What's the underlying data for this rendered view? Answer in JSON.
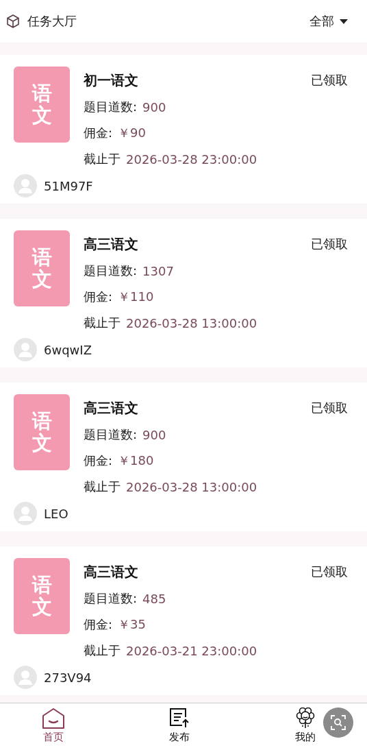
{
  "header": {
    "title": "任务大厅",
    "filter": "全部"
  },
  "tasks": [
    {
      "cover": "语文",
      "title": "初一语文",
      "status": "已领取",
      "count_label": "题目道数:",
      "count": "900",
      "fee_label": "佣金:",
      "fee": "￥90",
      "deadline_label": "截止于",
      "deadline": "2026-03-28 23:00:00",
      "user": "51M97F"
    },
    {
      "cover": "语文",
      "title": "高三语文",
      "status": "已领取",
      "count_label": "题目道数:",
      "count": "1307",
      "fee_label": "佣金:",
      "fee": "￥110",
      "deadline_label": "截止于",
      "deadline": "2026-03-28 13:00:00",
      "user": "6wqwIZ"
    },
    {
      "cover": "语文",
      "title": "高三语文",
      "status": "已领取",
      "count_label": "题目道数:",
      "count": "900",
      "fee_label": "佣金:",
      "fee": "￥180",
      "deadline_label": "截止于",
      "deadline": "2026-03-28 13:00:00",
      "user": "LEO"
    },
    {
      "cover": "语文",
      "title": "高三语文",
      "status": "已领取",
      "count_label": "题目道数:",
      "count": "485",
      "fee_label": "佣金:",
      "fee": "￥35",
      "deadline_label": "截止于",
      "deadline": "2026-03-21 23:00:00",
      "user": "273V94"
    }
  ],
  "tabbar": [
    {
      "kind": "home",
      "label": "首页",
      "selected": true
    },
    {
      "kind": "publish",
      "label": "发布",
      "selected": false
    },
    {
      "kind": "mine",
      "label": "我的",
      "selected": false
    }
  ]
}
